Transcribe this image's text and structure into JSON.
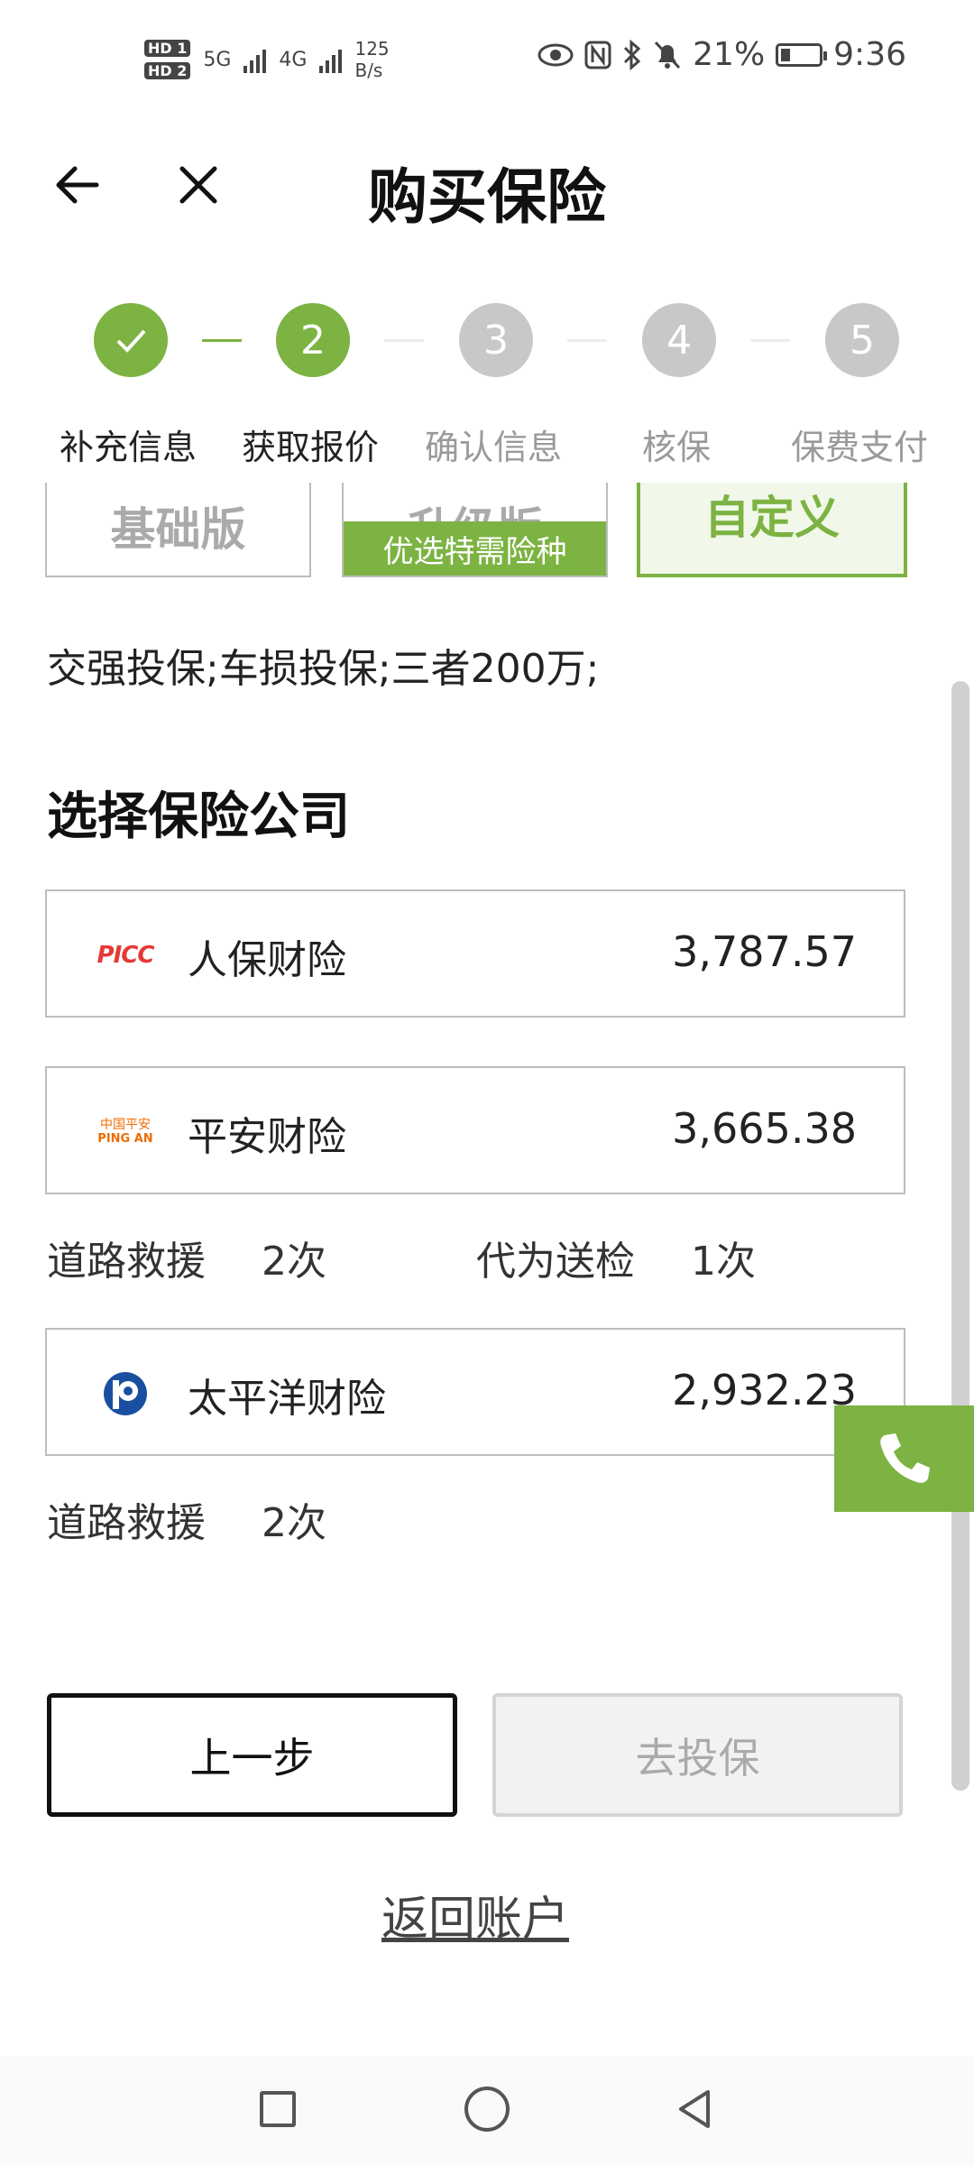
{
  "status_bar": {
    "hd1": "HD 1",
    "hd2": "HD 2",
    "net1": "5G",
    "net2": "4G",
    "speed_value": "125",
    "speed_unit": "B/s",
    "battery": "21%",
    "time": "9:36"
  },
  "header": {
    "title": "购买保险"
  },
  "stepper": {
    "steps": [
      {
        "label": "补充信息",
        "number": "",
        "state": "done"
      },
      {
        "label": "获取报价",
        "number": "2",
        "state": "current"
      },
      {
        "label": "确认信息",
        "number": "3",
        "state": "todo"
      },
      {
        "label": "核保",
        "number": "4",
        "state": "todo"
      },
      {
        "label": "保费支付",
        "number": "5",
        "state": "todo"
      }
    ]
  },
  "plans": [
    {
      "name": "基础版",
      "tag": ""
    },
    {
      "name": "升级版",
      "tag": "优选特需险种"
    },
    {
      "name": "自定义",
      "tag": "",
      "selected": true
    }
  ],
  "coverage_text": "交强投保;车损投保;三者200万;",
  "section_title": "选择保险公司",
  "companies": [
    {
      "name": "人保财险",
      "price": "3,787.57",
      "logo_text": "PICC",
      "services": []
    },
    {
      "name": "平安财险",
      "price": "3,665.38",
      "logo_text_cn": "中国平安",
      "logo_text_en": "PING AN",
      "services": [
        {
          "name": "道路救援",
          "count": "2次"
        },
        {
          "name": "代为送检",
          "count": "1次"
        }
      ]
    },
    {
      "name": "太平洋财险",
      "price": "2,932.23",
      "logo_text": "",
      "services": [
        {
          "name": "道路救援",
          "count": "2次"
        }
      ]
    }
  ],
  "buttons": {
    "prev": "上一步",
    "go": "去投保"
  },
  "return_link": "返回账户",
  "colors": {
    "accent": "#7cb342",
    "disabled": "#c8c8c8"
  }
}
